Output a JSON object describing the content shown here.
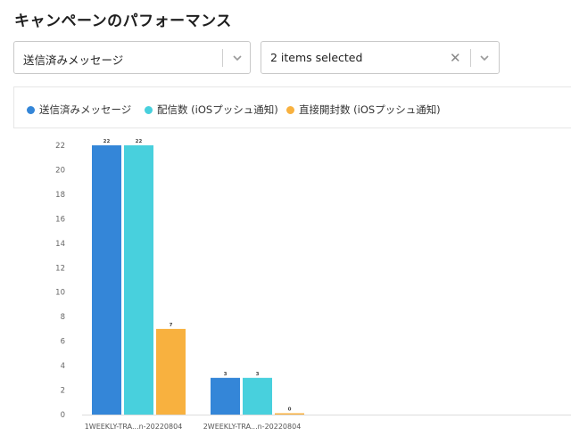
{
  "header": {
    "title": "キャンペーンのパフォーマンス"
  },
  "filters": {
    "metric_select": {
      "value": "送信済みメッセージ"
    },
    "campaign_select": {
      "value": "2 items selected",
      "clear_glyph": "✕"
    }
  },
  "colors": {
    "series1": "#3486d8",
    "series2": "#48d0dd",
    "series3": "#f8b13f"
  },
  "chart_data": {
    "type": "bar",
    "categories": [
      "1WEEKLY-TRA...n-20220804",
      "2WEEKLY-TRA...n-20220804"
    ],
    "series": [
      {
        "name": "送信済みメッセージ",
        "values": [
          22,
          3
        ]
      },
      {
        "name": "配信数 (iOSプッシュ通知)",
        "values": [
          22,
          3
        ]
      },
      {
        "name": "直接開封数 (iOSプッシュ通知)",
        "values": [
          7,
          0
        ]
      }
    ],
    "yticks": [
      0,
      2,
      4,
      6,
      8,
      10,
      12,
      14,
      16,
      18,
      20,
      22
    ],
    "ylim": [
      0,
      22
    ],
    "grid": false,
    "legend_position": "top"
  }
}
